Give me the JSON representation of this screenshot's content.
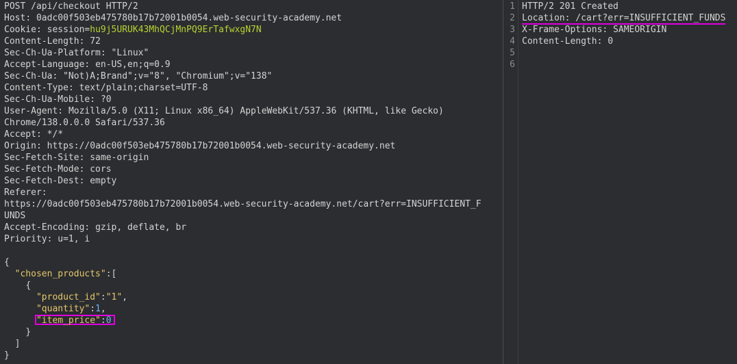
{
  "request": {
    "request_line": "POST /api/checkout HTTP/2",
    "headers": [
      {
        "name": "Host",
        "value": "0adc00f503eb475780b17b72001b0054.web-security-academy.net"
      },
      {
        "name": "Cookie",
        "value_prefix": "session=",
        "value": "hu9j5URUK43MhQCjMnPQ9ErTafwxgN7N"
      },
      {
        "name": "Content-Length",
        "value": "72"
      },
      {
        "name": "Sec-Ch-Ua-Platform",
        "value": "\"Linux\""
      },
      {
        "name": "Accept-Language",
        "value": "en-US,en;q=0.9"
      },
      {
        "name": "Sec-Ch-Ua",
        "value": "\"Not)A;Brand\";v=\"8\", \"Chromium\";v=\"138\""
      },
      {
        "name": "Content-Type",
        "value": "text/plain;charset=UTF-8"
      },
      {
        "name": "Sec-Ch-Ua-Mobile",
        "value": "?0"
      },
      {
        "name": "User-Agent",
        "value": "Mozilla/5.0 (X11; Linux x86_64) AppleWebKit/537.36 (KHTML, like Gecko)"
      },
      {
        "name": "",
        "value": "Chrome/138.0.0.0 Safari/537.36"
      },
      {
        "name": "Accept",
        "value": "*/*"
      },
      {
        "name": "Origin",
        "value": "https://0adc00f503eb475780b17b72001b0054.web-security-academy.net"
      },
      {
        "name": "Sec-Fetch-Site",
        "value": "same-origin"
      },
      {
        "name": "Sec-Fetch-Mode",
        "value": "cors"
      },
      {
        "name": "Sec-Fetch-Dest",
        "value": "empty"
      },
      {
        "name": "Referer",
        "value": ""
      },
      {
        "name": "",
        "value": "https://0adc00f503eb475780b17b72001b0054.web-security-academy.net/cart?err=INSUFFICIENT_F"
      },
      {
        "name": "",
        "value": "UNDS"
      },
      {
        "name": "Accept-Encoding",
        "value": "gzip, deflate, br"
      },
      {
        "name": "Priority",
        "value": "u=1, i"
      }
    ],
    "body": {
      "open_brace": "{",
      "chosen_products_key": "\"chosen_products\"",
      "chosen_products_sep": ":[",
      "item_open": "{",
      "product_id_key": "\"product_id\"",
      "product_id_value": "\"1\"",
      "quantity_key": "\"quantity\"",
      "quantity_value": "1",
      "item_price_key": "\"item_price\"",
      "item_price_value": "0",
      "item_close": "}",
      "array_close": "]",
      "close_brace": "}"
    }
  },
  "response": {
    "line_numbers": [
      "1",
      "2",
      "3",
      "4",
      "5",
      "6"
    ],
    "status_line": "HTTP/2 201 Created",
    "location_name": "Location:",
    "location_value": "/cart?err=INSUFFICIENT_FUNDS",
    "xframe": "X-Frame-Options: SAMEORIGIN",
    "content_length": "Content-Length: 0"
  },
  "colors": {
    "highlight": "#e000e0",
    "json_key": "#e6c76a",
    "json_number": "#6fb3ff",
    "cookie_value": "#b5d334"
  }
}
